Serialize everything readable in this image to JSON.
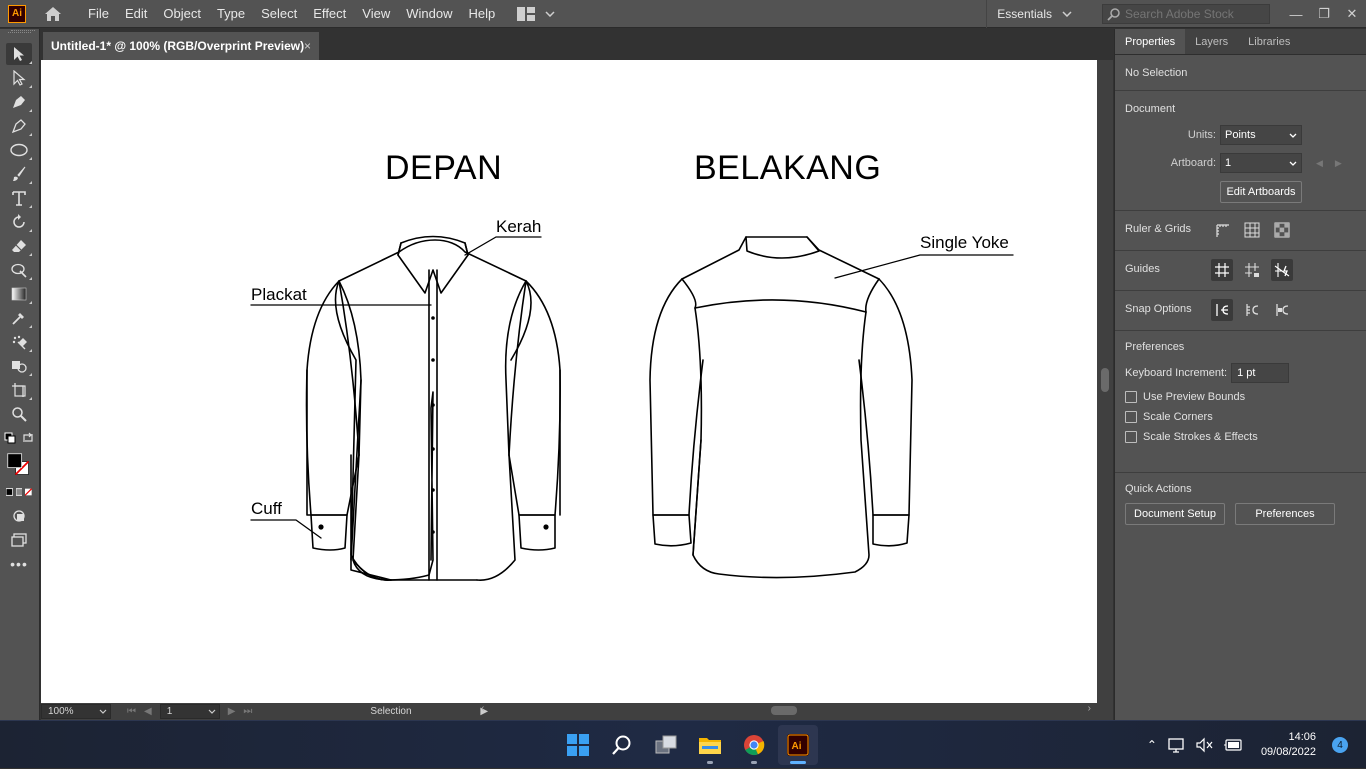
{
  "app": {
    "logo": "Ai",
    "menus": [
      "File",
      "Edit",
      "Object",
      "Type",
      "Select",
      "Effect",
      "View",
      "Window",
      "Help"
    ],
    "workspace": "Essentials",
    "search_placeholder": "Search Adobe Stock"
  },
  "document": {
    "tab_title": "Untitled-1* @ 100% (RGB/Overprint Preview)",
    "close": "×"
  },
  "artboard": {
    "front_title": "DEPAN",
    "back_title": "BELAKANG",
    "labels": {
      "kerah": "Kerah",
      "plackat": "Plackat",
      "cuff": "Cuff",
      "single_yoke": "Single Yoke"
    }
  },
  "statusbar": {
    "zoom": "100%",
    "artboard_number": "1",
    "tool": "Selection"
  },
  "properties": {
    "tabs": [
      "Properties",
      "Layers",
      "Libraries"
    ],
    "selection": "No Selection",
    "document_title": "Document",
    "units_label": "Units:",
    "units_value": "Points",
    "artboard_label": "Artboard:",
    "artboard_value": "1",
    "edit_artboards": "Edit Artboards",
    "rulers_grids": "Ruler & Grids",
    "guides": "Guides",
    "snap_options": "Snap Options",
    "preferences_title": "Preferences",
    "keyboard_increment_label": "Keyboard Increment:",
    "keyboard_increment_value": "1 pt",
    "checkboxes": [
      "Use Preview Bounds",
      "Scale Corners",
      "Scale Strokes & Effects"
    ],
    "quick_actions": "Quick Actions",
    "document_setup": "Document Setup",
    "preferences_button": "Preferences"
  },
  "taskbar": {
    "time": "14:06",
    "date": "09/08/2022",
    "notifications": "4"
  }
}
